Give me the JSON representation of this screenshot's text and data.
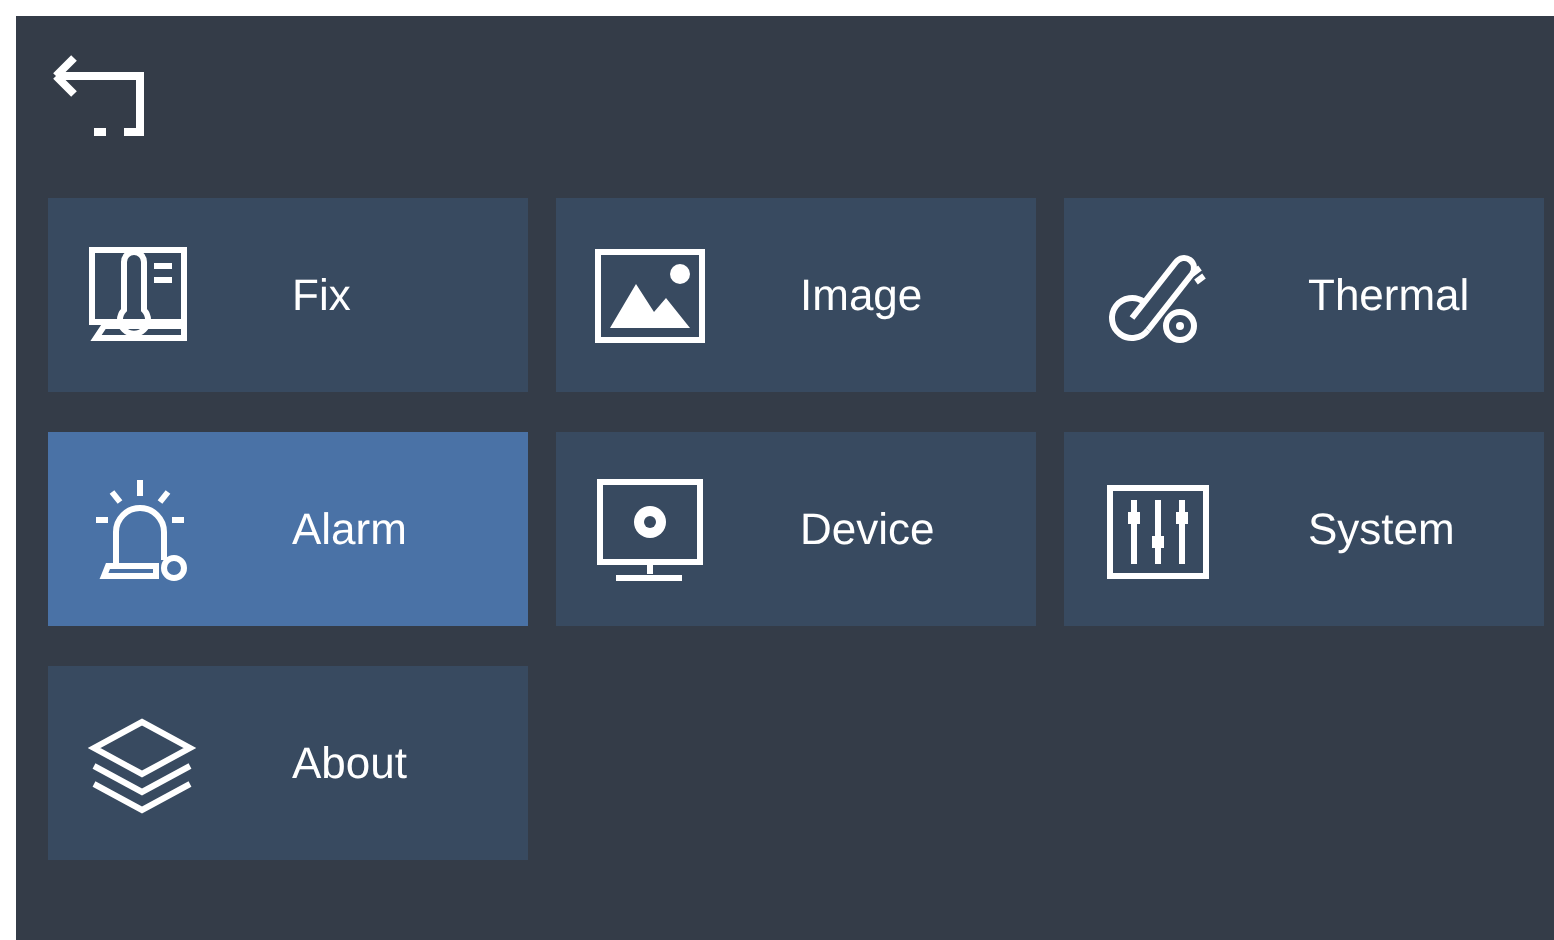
{
  "menu": [
    {
      "label": "Fix",
      "selected": false
    },
    {
      "label": "Image",
      "selected": false
    },
    {
      "label": "Thermal",
      "selected": false
    },
    {
      "label": "Alarm",
      "selected": true
    },
    {
      "label": "Device",
      "selected": false
    },
    {
      "label": "System",
      "selected": false
    },
    {
      "label": "About",
      "selected": false
    }
  ]
}
